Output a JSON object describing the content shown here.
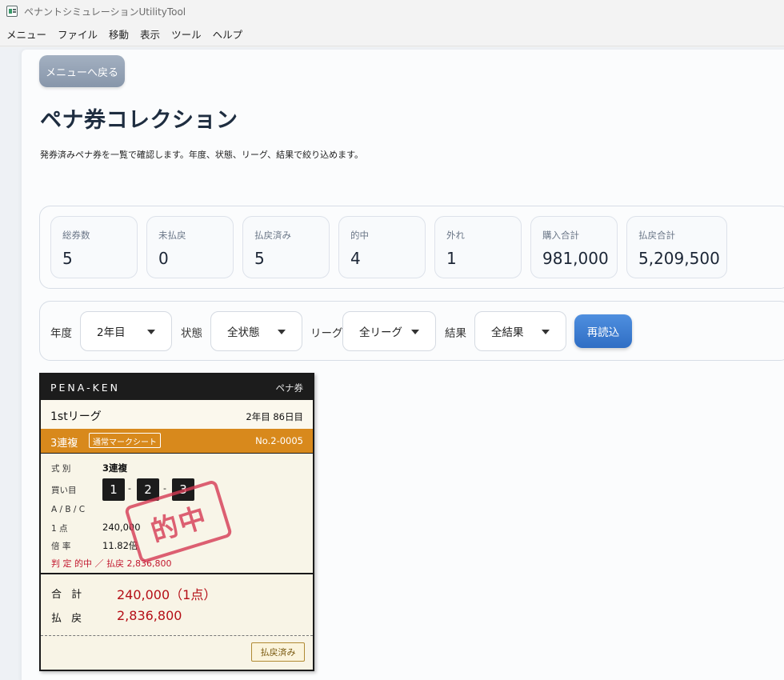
{
  "window": {
    "title": "ペナントシミュレーションUtilityTool"
  },
  "menubar": {
    "items": [
      "メニュー",
      "ファイル",
      "移動",
      "表示",
      "ツール",
      "ヘルプ"
    ]
  },
  "page": {
    "back_label": "メニューへ戻る",
    "title": "ペナ券コレクション",
    "description": "発券済みペナ券を一覧で確認します。年度、状態、リーグ、結果で絞り込めます。"
  },
  "stats": [
    {
      "label": "総券数",
      "value": "5"
    },
    {
      "label": "未払戻",
      "value": "0"
    },
    {
      "label": "払戻済み",
      "value": "5"
    },
    {
      "label": "的中",
      "value": "4"
    },
    {
      "label": "外れ",
      "value": "1"
    },
    {
      "label": "購入合計",
      "value": "981,000"
    },
    {
      "label": "払戻合計",
      "value": "5,209,500"
    }
  ],
  "filters": {
    "year": {
      "label": "年度",
      "value": "2年目"
    },
    "status": {
      "label": "状態",
      "value": "全状態"
    },
    "league": {
      "label": "リーグ",
      "value": "全リーグ"
    },
    "result": {
      "label": "結果",
      "value": "全結果"
    },
    "reload_label": "再読込"
  },
  "ticket": {
    "brand": "PENA-KEN",
    "kind": "ペナ券",
    "league": "1stリーグ",
    "day": "2年目  86日目",
    "bet_type": "3連複",
    "sheet_badge": "通常マークシート",
    "number": "No.2-0005",
    "type_label": "式 別",
    "type_value": "3連複",
    "picks_label": "買い目",
    "picks": [
      "1",
      "2",
      "3"
    ],
    "pick_separator": "-",
    "abc_label": "A / B / C",
    "unit_label": "1 点",
    "unit_value": "240,000",
    "odds_label": "倍 率",
    "odds_value": "11.82倍",
    "judge_text": "判 定  的中 ／ 払戻 2,836,800",
    "stamp_text": "的中",
    "total_label": "合 計",
    "total_value": "240,000（1点）",
    "payout_label": "払 戻",
    "payout_value": "2,836,800",
    "paid_badge": "払戻済み"
  },
  "colors": {
    "accent_blue": "#2f6ec4",
    "ticket_orange": "#d8891c",
    "hit_red": "#c2182f"
  }
}
